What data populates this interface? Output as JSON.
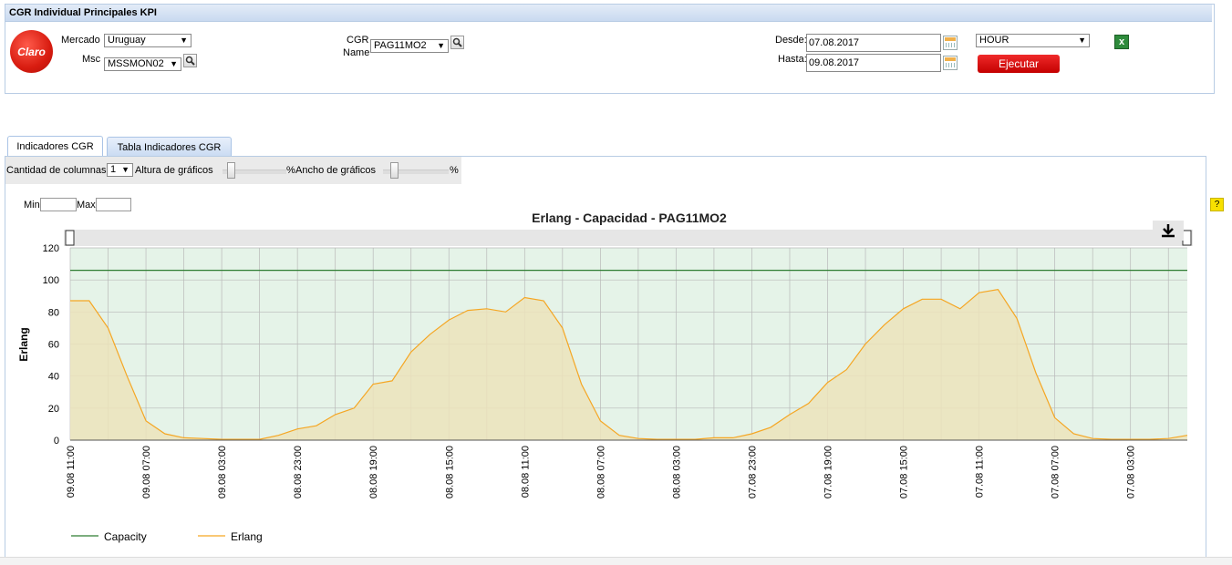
{
  "header": {
    "title": "CGR Individual Principales KPI"
  },
  "logo": {
    "text": "Claro"
  },
  "filters": {
    "mercado_label": "Mercado",
    "mercado_value": "Uruguay",
    "msc_label": "Msc",
    "msc_value": "MSSMON02",
    "cgr_label_1": "CGR",
    "cgr_label_2": "Name",
    "cgr_value": "PAG11MO2",
    "desde_label": "Desde:",
    "desde_value": "07.08.2017",
    "hasta_label": "Hasta:",
    "hasta_value": "09.08.2017",
    "granularity_value": "HOUR",
    "execute_label": "Ejecutar"
  },
  "tabs": [
    {
      "label": "Indicadores CGR",
      "active": true
    },
    {
      "label": "Tabla Indicadores CGR",
      "active": false
    }
  ],
  "controls": {
    "columns_label": "Cantidad de columnas",
    "columns_value": "1",
    "height_label": "Altura de gráficos",
    "height_unit": "%",
    "width_label": "Ancho de gráficos",
    "width_unit": "%",
    "min_label": "Min",
    "max_label": "Max",
    "help_label": "?"
  },
  "colors": {
    "capacity": "#2e7d32",
    "erlang": "#f5a623",
    "execute_button": "#d91515",
    "tab_border": "#aac4e6"
  },
  "chart_data": {
    "type": "line",
    "title": "Erlang - Capacidad - PAG11MO2",
    "ylabel": "Erlang",
    "xlabel": "",
    "ylim": [
      0,
      120
    ],
    "yticks": [
      0,
      20,
      40,
      60,
      80,
      100,
      120
    ],
    "x_tick_labels": [
      "09.08 11:00",
      "09.08 07:00",
      "09.08 03:00",
      "08.08 23:00",
      "08.08 19:00",
      "08.08 15:00",
      "08.08 11:00",
      "08.08 07:00",
      "08.08 03:00",
      "07.08 23:00",
      "07.08 19:00",
      "07.08 15:00",
      "07.08 11:00",
      "07.08 07:00",
      "07.08 03:00"
    ],
    "x_tick_step_hours": 4,
    "grid": true,
    "legend_position": "bottom-left",
    "series": [
      {
        "name": "Capacity",
        "values": [
          106,
          106,
          106,
          106,
          106,
          106,
          106,
          106,
          106,
          106,
          106,
          106,
          106,
          106,
          106,
          106,
          106,
          106,
          106,
          106,
          106,
          106,
          106,
          106,
          106,
          106,
          106,
          106,
          106,
          106,
          106,
          106,
          106,
          106,
          106,
          106,
          106,
          106,
          106,
          106,
          106,
          106,
          106,
          106,
          106,
          106,
          106,
          106,
          106,
          106,
          106,
          106,
          106,
          106,
          106,
          106,
          106,
          106,
          106,
          106
        ]
      },
      {
        "name": "Erlang",
        "values": [
          87,
          87,
          70,
          40,
          12,
          4,
          1.5,
          1,
          0.5,
          0.5,
          0.5,
          3,
          7,
          9,
          16,
          20,
          35,
          37,
          55,
          66,
          75,
          81,
          82,
          80,
          89,
          87,
          70,
          35,
          12,
          3,
          1,
          0.5,
          0.5,
          0.5,
          1.5,
          1.5,
          4,
          8,
          16,
          23,
          36,
          44,
          60,
          72,
          82,
          88,
          88,
          82,
          92,
          94,
          76,
          42,
          14,
          4,
          1,
          0.5,
          0.5,
          0.5,
          1,
          3
        ]
      }
    ]
  }
}
